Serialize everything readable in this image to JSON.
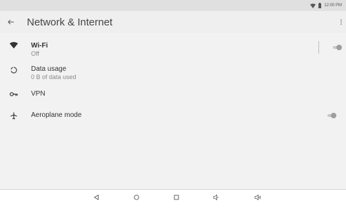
{
  "status_bar": {
    "time": "12:00 PM",
    "wifi_icon": "wifi-icon",
    "battery_icon": "battery-icon"
  },
  "app_bar": {
    "title": "Network & Internet",
    "back_icon": "arrow-back-icon",
    "more_icon": "more-vert-icon"
  },
  "settings": [
    {
      "id": "wifi",
      "title": "Wi-Fi",
      "subtitle": "Off",
      "icon": "wifi-icon",
      "toggle": false
    },
    {
      "id": "data-usage",
      "title": "Data usage",
      "subtitle": "0 B of data used",
      "icon": "data-usage-icon"
    },
    {
      "id": "vpn",
      "title": "VPN",
      "icon": "vpn-key-icon"
    },
    {
      "id": "aeroplane-mode",
      "title": "Aeroplane mode",
      "icon": "airplane-icon",
      "toggle": false
    }
  ],
  "nav_bar": {
    "buttons": [
      "back-triangle-icon",
      "home-circle-icon",
      "recents-square-icon",
      "volume-down-icon",
      "volume-up-icon"
    ]
  },
  "colors": {
    "status_bar_bg": "#e0e0e0",
    "app_bar_bg": "#efefef",
    "content_bg": "#f2f2f2",
    "text_primary": "#333333",
    "text_secondary": "#8a8a8a"
  }
}
